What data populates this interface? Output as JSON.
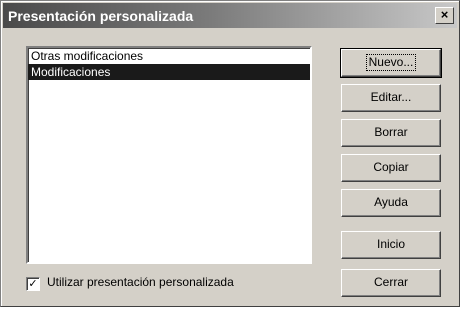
{
  "window": {
    "title": "Presentación personalizada",
    "close_glyph": "×"
  },
  "list": {
    "items": [
      {
        "label": "Otras modificaciones",
        "selected": false
      },
      {
        "label": "Modificaciones",
        "selected": true
      }
    ]
  },
  "buttons": {
    "nuevo": "Nuevo...",
    "editar": "Editar...",
    "borrar": "Borrar",
    "copiar": "Copiar",
    "ayuda": "Ayuda",
    "inicio": "Inicio",
    "cerrar": "Cerrar"
  },
  "checkbox": {
    "label": "Utilizar presentación personalizada",
    "checked": true,
    "check_glyph": "✓"
  }
}
